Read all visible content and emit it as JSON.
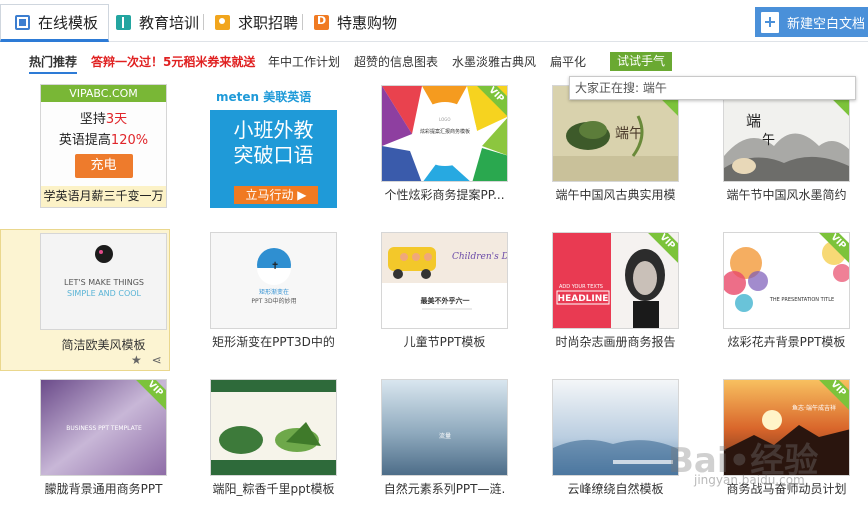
{
  "tabs": [
    {
      "label": "在线模板",
      "icon": "online-template-icon"
    },
    {
      "label": "教育培训",
      "icon": "education-icon"
    },
    {
      "label": "求职招聘",
      "icon": "job-icon"
    },
    {
      "label": "特惠购物",
      "icon": "shopping-icon"
    }
  ],
  "new_blank_label": "新建空白文档",
  "filters": {
    "hot": "热门推荐",
    "promo": "答辩一次过！5元稻米券来就送",
    "f1": "年中工作计划",
    "f2": "超赞的信息图表",
    "f3": "水墨淡雅古典风",
    "f4": "扁平化",
    "try": "试试手气"
  },
  "search_hint": "大家正在搜: 端午",
  "ad1": {
    "domain": "VIPABC.COM",
    "line1_a": "坚持",
    "line1_b": "3天",
    "line2_a": "英语提高",
    "line2_b": "120%",
    "button": "充电",
    "caption": "学英语月薪三千变一万"
  },
  "ad2": {
    "brand": "meten 美联英语",
    "line1": "小班外教",
    "line2": "突破口语",
    "cta": "立马行动 ▶"
  },
  "thumb_text": {
    "r1c3": "炫彩提案汇报商务模板",
    "r2c1_a": "LET'S MAKE THINGS",
    "r2c1_b": "SIMPLE AND COOL",
    "r2c2_a": "矩形渐变在",
    "r2c2_b": "PPT 3D中的妙用",
    "r2c3_a": "最美不外乎六一",
    "r2c4_a": "HEADLINE",
    "r2c4_b": "ADD YOUR TEXTS",
    "r2c5": "THE PRESENTATION TITLE",
    "r3c1": "BUSINESS PPT TEMPLATE",
    "r3c5_a": "鱼志·端午成吉祥",
    "r3c3": "流量"
  },
  "captions": [
    "",
    "",
    "个性炫彩商务提案PP...",
    "端午中国风古典实用模",
    "端午节中国风水墨简约",
    "简洁欧美风模板",
    "矩形渐变在PPT3D中的",
    "儿童节PPT模板",
    "时尚杂志画册商务报告",
    "炫彩花卉背景PPT模板",
    "朦胧背景通用商务PPT",
    "端阳_粽香千里ppt模板",
    "自然元素系列PPT—涟.",
    "云峰缭绕自然模板",
    "商务战马奋师动员计划"
  ],
  "vip_label": "VIP",
  "watermark": {
    "main": "Bai•经验",
    "sub": "jingyan.baidu.com"
  }
}
